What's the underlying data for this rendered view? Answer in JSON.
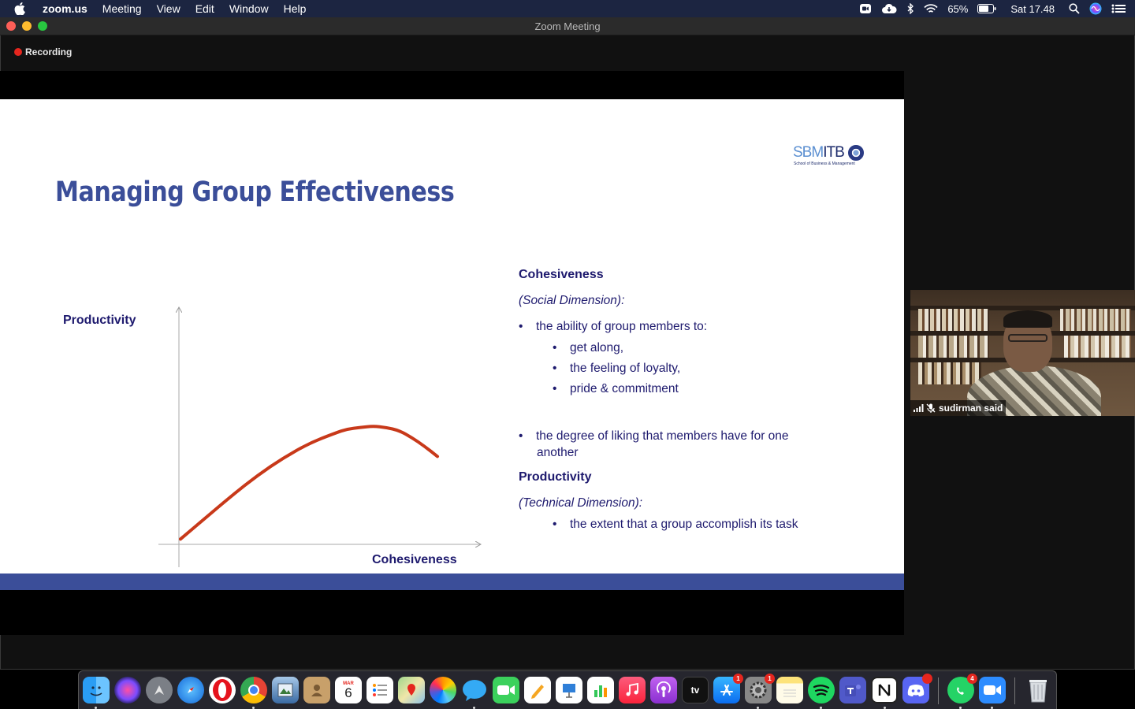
{
  "menubar": {
    "app": "zoom.us",
    "items": [
      "Meeting",
      "View",
      "Edit",
      "Window",
      "Help"
    ],
    "battery": "65%",
    "clock": "Sat 17.48"
  },
  "window": {
    "title": "Zoom Meeting",
    "recording": "Recording"
  },
  "slide": {
    "title": "Managing Group Effectiveness",
    "logo": {
      "brand_left": "SBM",
      "brand_right": "ITB",
      "subtitle": "School of Business & Management"
    },
    "chart_y_label": "Productivity",
    "chart_x_label": "Cohesiveness",
    "cohesiveness_heading": "Cohesiveness",
    "social_dimension": "(Social Dimension):",
    "bullet_ability": "the ability of group members to:",
    "sub_get_along": "get along,",
    "sub_loyalty": "the feeling of loyalty,",
    "sub_pride": "pride & commitment",
    "bullet_liking_1": "the degree of liking that members have for one",
    "bullet_liking_2": "another",
    "productivity_heading": "Productivity",
    "technical_dimension": "(Technical Dimension):",
    "sub_task": "the extent that a group accomplish its task"
  },
  "chart_data": {
    "type": "line",
    "xlabel": "Cohesiveness",
    "ylabel": "Productivity",
    "x": [
      0,
      10,
      20,
      30,
      40,
      50,
      60,
      65,
      70,
      75,
      80,
      85,
      90,
      95,
      100
    ],
    "series": [
      {
        "values": [
          2,
          17,
          32,
          46,
          58,
          68,
          75,
          78,
          79,
          80,
          79,
          77,
          72,
          66,
          59
        ]
      }
    ],
    "xlim": [
      0,
      100
    ],
    "ylim": [
      0,
      100
    ],
    "color": "#c8391a"
  },
  "participant": {
    "name": "sudirman said"
  },
  "colors": {
    "menubar": "#1c2541",
    "slide_title": "#3b4e99",
    "slide_text": "#1e1a6e",
    "footer_bar": "#3b4e99",
    "recording_dot": "#e5261e"
  },
  "dock": {
    "apps": [
      "Finder",
      "Siri",
      "Launchpad",
      "Safari",
      "Opera",
      "Chrome",
      "Preview",
      "Contacts",
      "Calendar",
      "Reminders",
      "Maps",
      "Photos",
      "Messages",
      "FaceTime",
      "Pages",
      "Keynote",
      "Numbers",
      "Music",
      "Podcasts",
      "TV",
      "App Store",
      "System Preferences",
      "Notes",
      "Spotify",
      "Teams",
      "Notion",
      "Discord",
      "WhatsApp",
      "Zoom",
      "Trash"
    ],
    "calendar_month": "MAR",
    "calendar_day": "6",
    "tv_label": "tv",
    "appstore_badge": "1",
    "sysprefs_badge": "1",
    "whatsapp_badge": "4"
  }
}
